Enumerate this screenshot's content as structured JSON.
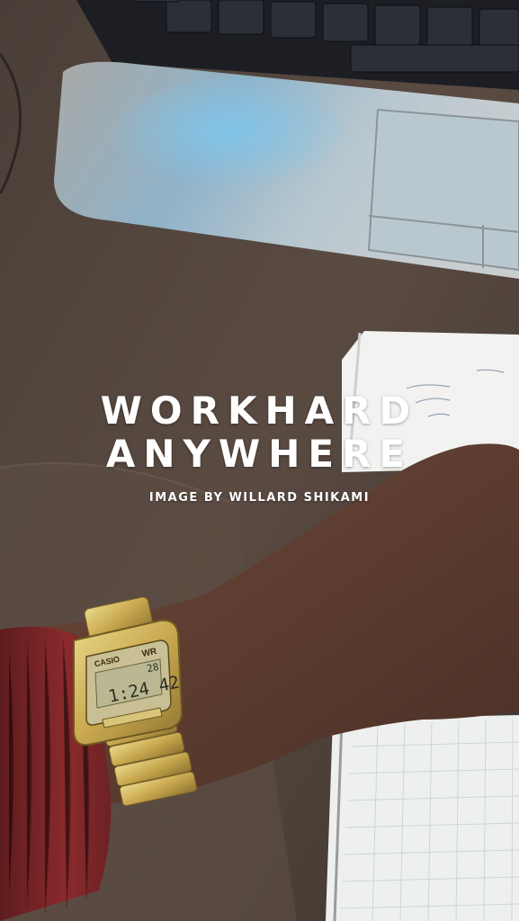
{
  "headline": {
    "line1": "WORKHARD",
    "line2": "ANYWHERE"
  },
  "credit": "IMAGE BY WILLARD SHIKAMI",
  "watch": {
    "brand": "CASIO",
    "badge": "WR",
    "date": "28",
    "time": "1:24 42"
  }
}
